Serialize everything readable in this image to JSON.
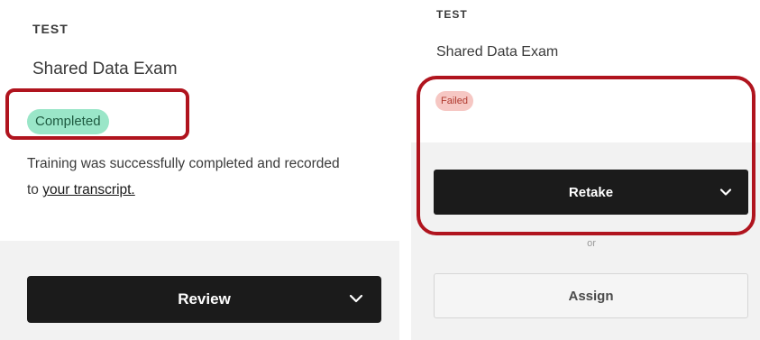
{
  "left_card": {
    "type_label": "TEST",
    "title": "Shared Data Exam",
    "status_badge": "Completed",
    "message_prefix": "Training was successfully completed and recorded to ",
    "transcript_link": "your transcript.",
    "review_button": "Review",
    "chevron_icon": "chevron-down-icon"
  },
  "right_card": {
    "type_label": "TEST",
    "title": "Shared Data Exam",
    "status_badge": "Failed",
    "retake_button": "Retake",
    "chevron_icon": "chevron-down-icon",
    "or_text": "or",
    "assign_button": "Assign"
  },
  "colors": {
    "highlight_outline": "#b0141e",
    "completed_badge_bg": "#9ae6c8",
    "failed_badge_bg": "#f6c7c3",
    "primary_button_bg": "#1b1b1b"
  }
}
